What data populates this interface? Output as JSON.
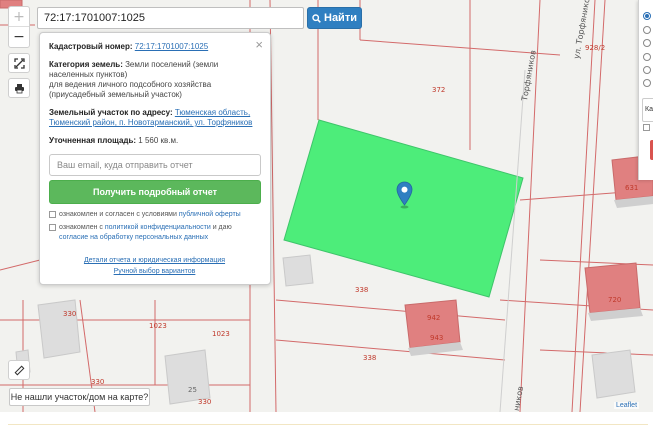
{
  "search": {
    "value": "72:17:1701007:1025",
    "button_label": "Найти"
  },
  "popup": {
    "cadastral_label": "Кадастровый номер:",
    "cadastral_value": "72:17:1701007:1025",
    "category_label": "Категория земель:",
    "category_value": "Земли поселений (земли населенных пунктов)",
    "purpose_value": "для ведения личного подсобного хозяйства (приусадебный земельный участок)",
    "address_label": "Земельный участок по адресу:",
    "address_value": "Тюменская область, Тюменский район, п. Новотарманский, ул. Торфяников",
    "area_label": "Уточненная площадь:",
    "area_value": "1 560 кв.м.",
    "email_placeholder": "Ваш email, куда отправить отчет",
    "report_button": "Получить подробный отчет",
    "agree1_text": "ознакомлен и согласен с условиями",
    "agree1_link": "публичной оферты",
    "agree2_text": "ознакомлен с",
    "agree2_link1": "политикой конфиденциальности",
    "agree2_mid": "и даю",
    "agree2_link2": "согласие на обработку персональных данных",
    "details_link": "Детали отчета и юридическая информация",
    "manual_link": "Ручной выбор вариантов",
    "close_symbol": "×"
  },
  "map": {
    "labels": {
      "l372": "372",
      "l928": "928/2",
      "l338a": "338",
      "l338b": "338",
      "l330a": "330",
      "l330b": "330",
      "l330c": "330",
      "l1023a": "1023",
      "l1023b": "1023",
      "l25": "25",
      "l720": "720",
      "l631": "631",
      "l942": "942",
      "l943": "943",
      "street1": "ул. Торфяников",
      "street2": "Торфяников",
      "street3": "ников"
    },
    "parcel_color": "#4ded7a",
    "highlight_color": "#e08080",
    "marker_color": "#2f7fc1"
  },
  "not_found_button": "Не нашли участок/дом на карте?",
  "attribution": "Leaflet",
  "right_panel": {
    "input_fragment": "Ка"
  },
  "icons": [
    "search-icon",
    "zoom-in-icon",
    "zoom-out-icon",
    "fullscreen-icon",
    "print-icon",
    "ruler-icon",
    "map-marker-icon",
    "close-icon"
  ]
}
